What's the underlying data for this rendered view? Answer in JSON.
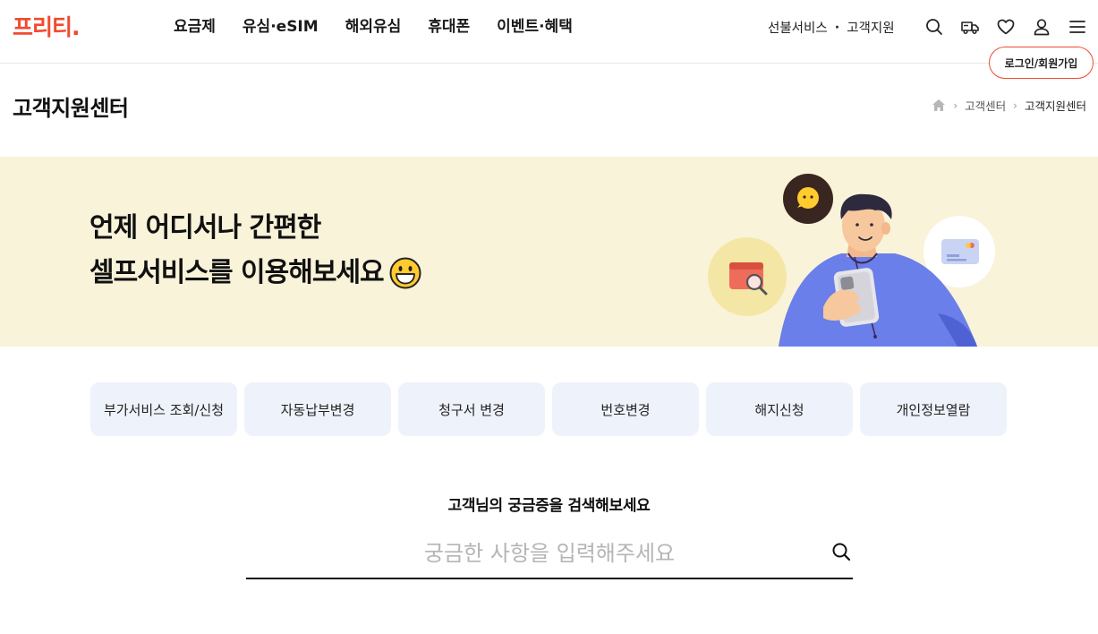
{
  "brand": {
    "logo_text": "프리티.",
    "accent": "#f04b2f"
  },
  "gnb": {
    "items": [
      "요금제",
      "유심·eSIM",
      "해외유심",
      "휴대폰",
      "이벤트·혜택"
    ]
  },
  "util": {
    "prepaid": "선불서비스",
    "support": "고객지원",
    "icons": [
      "search-icon",
      "delivery-truck-icon",
      "heart-icon",
      "user-icon",
      "hamburger-menu-icon"
    ]
  },
  "login_tooltip": "로그인/회원가입",
  "page": {
    "title": "고객지원센터",
    "breadcrumb": [
      "고객센터",
      "고객지원센터"
    ]
  },
  "banner": {
    "line1": "언제 어디서나 간편한",
    "line2": "셀프서비스를 이용해보세요",
    "bg": "#f8f3d9"
  },
  "quick_menu": [
    "부가서비스 조회/신청",
    "자동납부변경",
    "청구서 변경",
    "번호변경",
    "해지신청",
    "개인정보열람"
  ],
  "search": {
    "heading": "고객님의 궁금증을 검색해보세요",
    "placeholder": "궁금한 사항을 입력해주세요",
    "value": ""
  }
}
